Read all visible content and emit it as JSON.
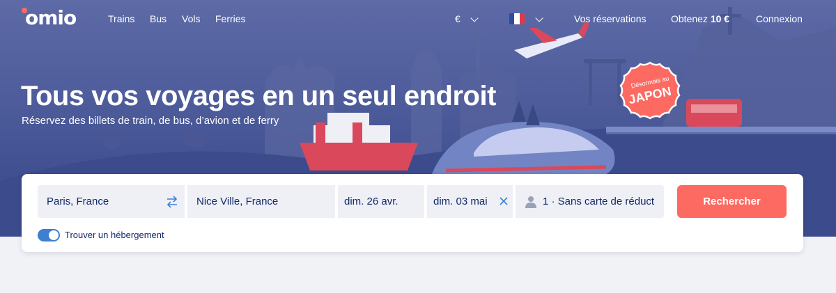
{
  "nav": {
    "logo": "omio",
    "links": [
      {
        "label": "Trains"
      },
      {
        "label": "Bus"
      },
      {
        "label": "Vols"
      },
      {
        "label": "Ferries"
      }
    ],
    "currency": "€",
    "language_flag": "france-flag",
    "bookings": "Vos réservations",
    "promo_prefix": "Obtenez",
    "promo_amount": "10 €",
    "login": "Connexion"
  },
  "hero": {
    "title": "Tous vos voyages en un seul endroit",
    "subtitle": "Réservez des billets de train, de bus, d’avion et de ferry",
    "badge_small": "Désormais au",
    "badge_big": "JAPON"
  },
  "search": {
    "from": "Paris, France",
    "to": "Nice Ville, France",
    "departure": "dim. 26 avr.",
    "return": "dim. 03 mai",
    "passengers": "1 · Sans carte de réduct",
    "button": "Rechercher",
    "accommodation_toggle": "Trouver un hébergement",
    "accommodation_enabled": true
  },
  "colors": {
    "accent": "#fc6a62",
    "toggle": "#3d7fd0",
    "text_dark": "#132968",
    "hero_bg": "#4f5d9c"
  }
}
